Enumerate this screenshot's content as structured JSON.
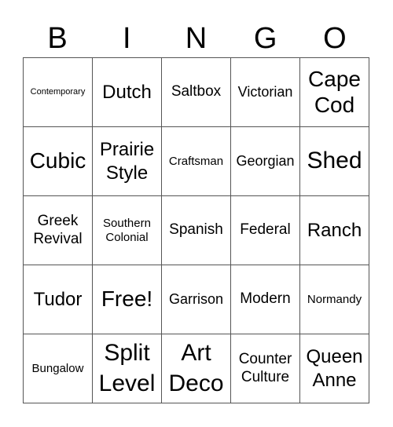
{
  "header": {
    "letters": [
      "B",
      "I",
      "N",
      "G",
      "O"
    ]
  },
  "board": {
    "rows": [
      [
        "Contemporary",
        "Dutch",
        "Saltbox",
        "Victorian",
        "Cape Cod"
      ],
      [
        "Cubic",
        "Prairie Style",
        "Craftsman",
        "Georgian",
        "Shed"
      ],
      [
        "Greek Revival",
        "Southern Colonial",
        "Spanish",
        "Federal",
        "Ranch"
      ],
      [
        "Tudor",
        "Free!",
        "Garrison",
        "Modern",
        "Normandy"
      ],
      [
        "Bungalow",
        "Split Level",
        "Art Deco",
        "Counter Culture",
        "Queen Anne"
      ]
    ]
  }
}
